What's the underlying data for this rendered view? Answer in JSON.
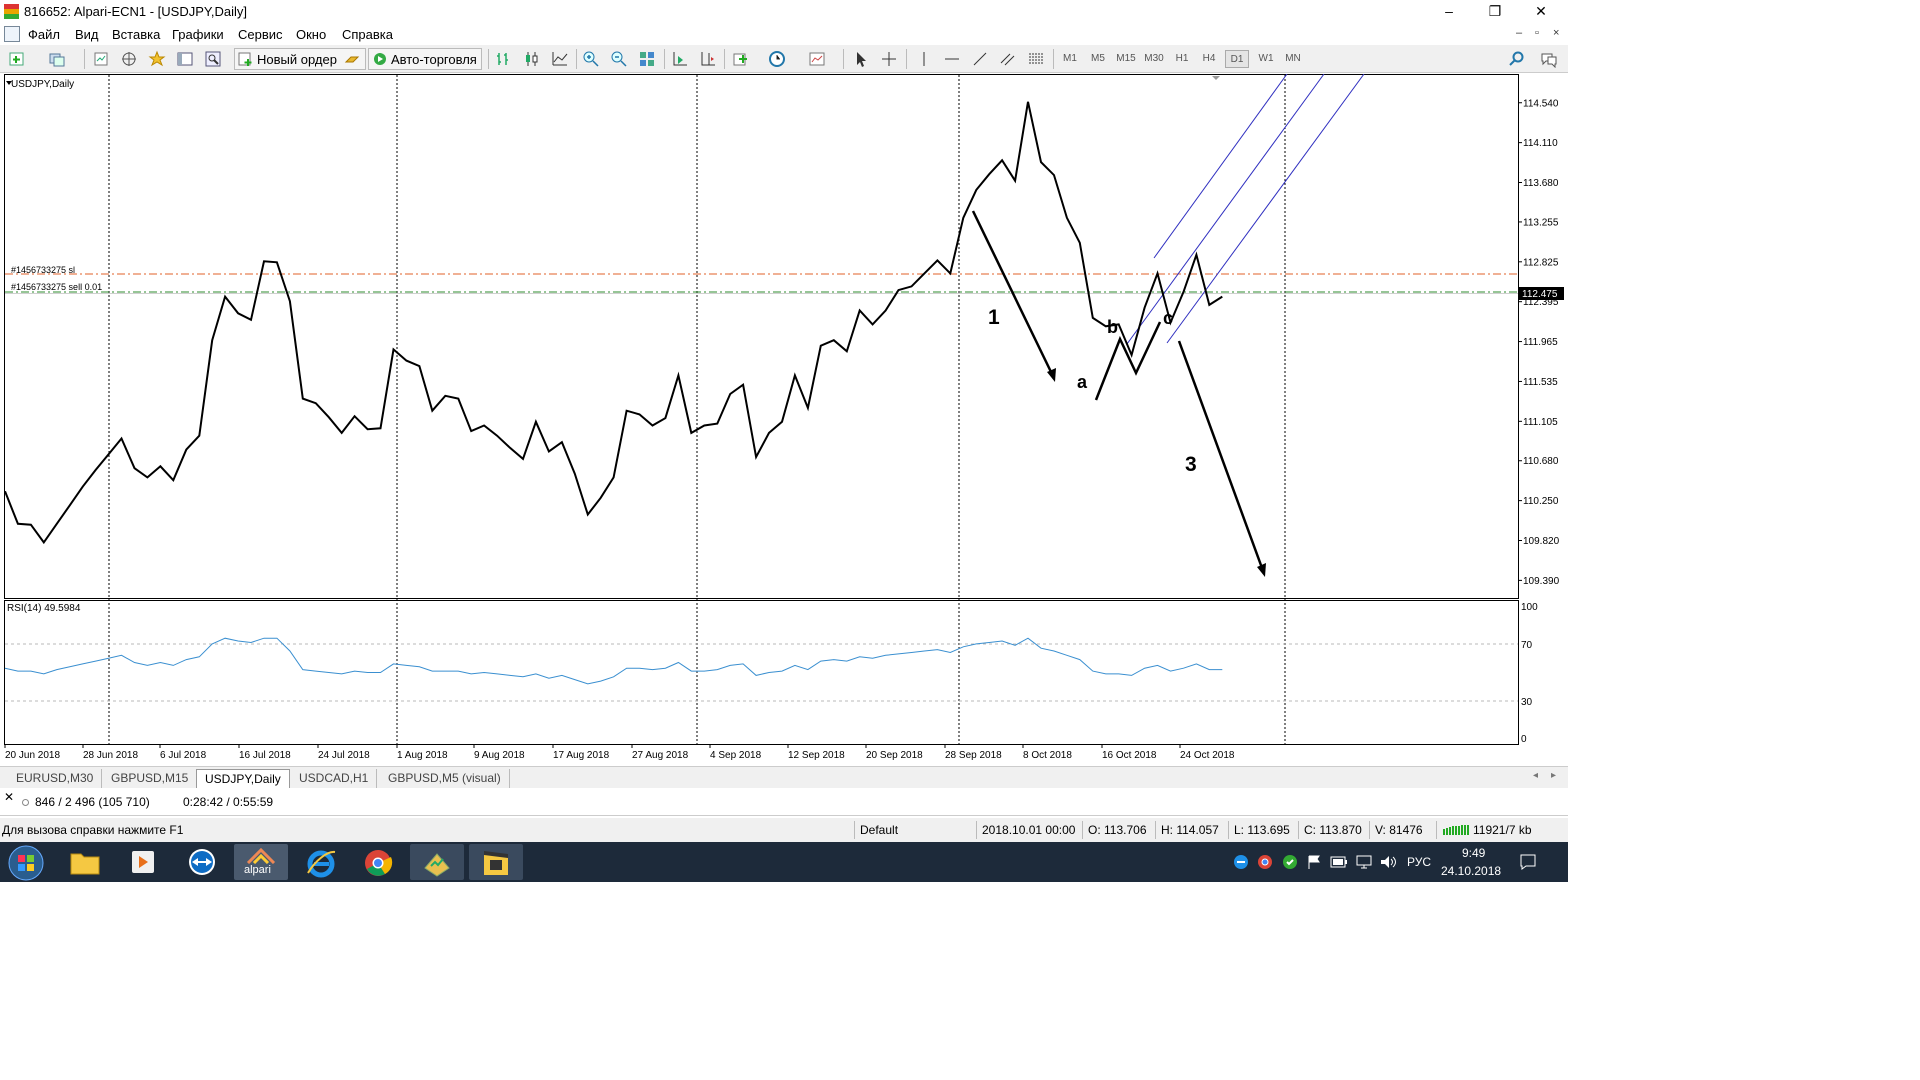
{
  "window": {
    "title": "816652: Alpari-ECN1 - [USDJPY,Daily]",
    "minimize": "–",
    "maximize": "❐",
    "close": "✕"
  },
  "menu": {
    "items": [
      "Файл",
      "Вид",
      "Вставка",
      "Графики",
      "Сервис",
      "Окно",
      "Справка"
    ],
    "mdi": [
      "–",
      "▫",
      "×"
    ]
  },
  "toolbar": {
    "new_order": "Новый ордер",
    "auto_trading": "Авто-торговля",
    "timeframes": [
      "M1",
      "M5",
      "M15",
      "M30",
      "H1",
      "H4",
      "D1",
      "W1",
      "MN"
    ],
    "active_timeframe": "D1"
  },
  "chart": {
    "symbol_label": "USDJPY,Daily",
    "sl_label": "#1456733275 sl",
    "order_label": "#1456733275 sell 0.01",
    "current_price": "112.475",
    "rsi_label": "RSI(14) 49.5984",
    "rsi_levels": [
      "100",
      "70",
      "30",
      "0"
    ],
    "annotations": [
      "1",
      "a",
      "b",
      "c",
      "3"
    ],
    "colors": {
      "price_line": "#000000",
      "sl_line": "#e0602a",
      "order_line": "#2e8b2e",
      "channel": "#3030c0",
      "rsi_line": "#3a8fd0",
      "price_tag_bg": "#000000"
    }
  },
  "chart_data": {
    "type": "line",
    "title": "USDJPY,Daily",
    "price_ticks": [
      "114.540",
      "114.110",
      "113.680",
      "113.255",
      "112.825",
      "112.395",
      "111.965",
      "111.535",
      "111.105",
      "110.680",
      "110.250",
      "109.820",
      "109.390"
    ],
    "x_ticks": [
      "20 Jun 2018",
      "28 Jun 2018",
      "6 Jul 2018",
      "16 Jul 2018",
      "24 Jul 2018",
      "1 Aug 2018",
      "9 Aug 2018",
      "17 Aug 2018",
      "27 Aug 2018",
      "4 Sep 2018",
      "12 Sep 2018",
      "20 Sep 2018",
      "28 Sep 2018",
      "8 Oct 2018",
      "16 Oct 2018",
      "24 Oct 2018"
    ],
    "ylim": [
      109.2,
      114.85
    ],
    "close": [
      110.35,
      110.0,
      109.99,
      109.8,
      110.0,
      110.2,
      110.4,
      110.58,
      110.75,
      110.92,
      110.6,
      110.5,
      110.62,
      110.47,
      110.8,
      110.95,
      111.98,
      112.45,
      112.27,
      112.2,
      112.83,
      112.82,
      112.4,
      111.35,
      111.3,
      111.15,
      110.98,
      111.16,
      111.02,
      111.03,
      111.88,
      111.76,
      111.7,
      111.22,
      111.38,
      111.35,
      111.0,
      111.06,
      110.95,
      110.82,
      110.7,
      111.1,
      110.78,
      110.88,
      110.54,
      110.1,
      110.28,
      110.5,
      111.22,
      111.18,
      111.06,
      111.14,
      111.6,
      110.98,
      111.06,
      111.08,
      111.4,
      111.5,
      110.72,
      110.98,
      111.1,
      111.6,
      111.25,
      111.92,
      111.98,
      111.86,
      112.3,
      112.15,
      112.3,
      112.52,
      112.56,
      112.7,
      112.84,
      112.7,
      113.3,
      113.6,
      113.77,
      113.92,
      113.7,
      114.55,
      113.9,
      113.76,
      113.3,
      113.03,
      112.22,
      112.13,
      112.15,
      111.82,
      112.33,
      112.7,
      112.17,
      112.5,
      112.9,
      112.36,
      112.45
    ]
  },
  "rsi_data": {
    "type": "line",
    "ylim": [
      0,
      100
    ],
    "values": [
      53,
      51,
      51,
      49,
      52,
      54,
      56,
      58,
      60,
      62,
      57,
      55,
      57,
      55,
      59,
      61,
      70,
      74,
      72,
      71,
      74,
      74,
      65,
      52,
      51,
      50,
      49,
      51,
      50,
      50,
      56,
      55,
      54,
      51,
      51,
      51,
      49,
      50,
      49,
      48,
      47,
      49,
      46,
      48,
      45,
      42,
      44,
      47,
      53,
      53,
      52,
      53,
      57,
      51,
      51,
      52,
      55,
      56,
      48,
      50,
      51,
      55,
      52,
      58,
      59,
      58,
      61,
      60,
      62,
      63,
      64,
      65,
      66,
      64,
      68,
      70,
      71,
      72,
      69,
      74,
      67,
      65,
      62,
      59,
      51,
      49,
      49,
      48,
      53,
      55,
      51,
      53,
      56,
      52,
      52
    ]
  },
  "tabs": [
    "EURUSD,M30",
    "GBPUSD,M15",
    "USDJPY,Daily",
    "USDCAD,H1",
    "GBPUSD,M5 (visual)"
  ],
  "active_tab": "USDJPY,Daily",
  "infobar": {
    "bars": "846 / 2 496 (105 710)",
    "time": "0:28:42 / 0:55:59"
  },
  "statusbar": {
    "help": "Для вызова справки нажмите F1",
    "profile": "Default",
    "datetime": "2018.10.01 00:00",
    "open": "O: 113.706",
    "high": "H: 114.057",
    "low": "L: 113.695",
    "close": "C: 113.870",
    "volume": "V: 81476",
    "traffic": "11921/7 kb"
  },
  "taskbar": {
    "lang": "РУС",
    "clock_time": "9:49",
    "clock_date": "24.10.2018",
    "alpari_label": "alpari"
  }
}
